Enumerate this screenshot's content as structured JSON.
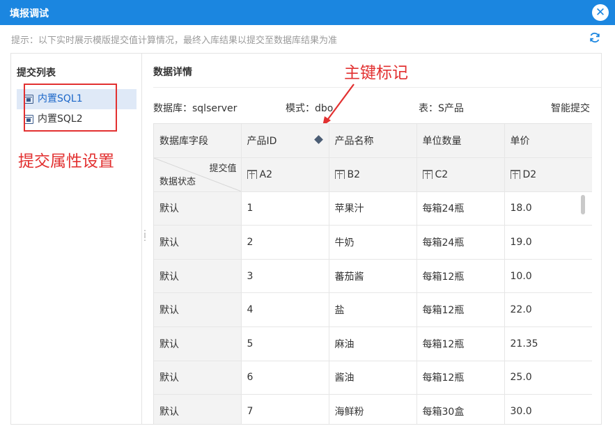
{
  "window": {
    "title": "填报调试"
  },
  "hint": "提示：以下实时展示模版提交值计算情况，最终入库结果以提交至数据库结果为准",
  "left": {
    "title": "提交列表",
    "items": [
      {
        "label": "内置SQL1",
        "selected": true
      },
      {
        "label": "内置SQL2",
        "selected": false
      }
    ]
  },
  "annotations": {
    "left": "提交属性设置",
    "top": "主键标记"
  },
  "detail": {
    "title": "数据详情",
    "database": "数据库：sqlserver",
    "schema": "模式：dbo",
    "table": "表：S产品",
    "smart_submit": "智能提交"
  },
  "grid": {
    "field_label": "数据库字段",
    "diag_top": "提交值",
    "diag_bottom": "数据状态",
    "columns": [
      "产品ID",
      "产品名称",
      "单位数量",
      "单价"
    ],
    "primary_key_column": "产品ID",
    "refs": [
      "A2",
      "B2",
      "C2",
      "D2"
    ],
    "rows": [
      {
        "state": "默认",
        "values": [
          "1",
          "苹果汁",
          "每箱24瓶",
          "18.0"
        ]
      },
      {
        "state": "默认",
        "values": [
          "2",
          "牛奶",
          "每箱24瓶",
          "19.0"
        ]
      },
      {
        "state": "默认",
        "values": [
          "3",
          "蕃茄酱",
          "每箱12瓶",
          "10.0"
        ]
      },
      {
        "state": "默认",
        "values": [
          "4",
          "盐",
          "每箱12瓶",
          "22.0"
        ]
      },
      {
        "state": "默认",
        "values": [
          "5",
          "麻油",
          "每箱12瓶",
          "21.35"
        ]
      },
      {
        "state": "默认",
        "values": [
          "6",
          "酱油",
          "每箱12瓶",
          "25.0"
        ]
      },
      {
        "state": "默认",
        "values": [
          "7",
          "海鲜粉",
          "每箱30盒",
          "30.0"
        ]
      }
    ]
  },
  "icons": {
    "close": "close-icon",
    "refresh": "refresh-icon",
    "db": "database-icon",
    "cell_ref": "cell-ref-icon"
  },
  "colors": {
    "accent": "#1b86e0",
    "annotation": "#e23030",
    "selected_bg": "#dfe9f7"
  }
}
